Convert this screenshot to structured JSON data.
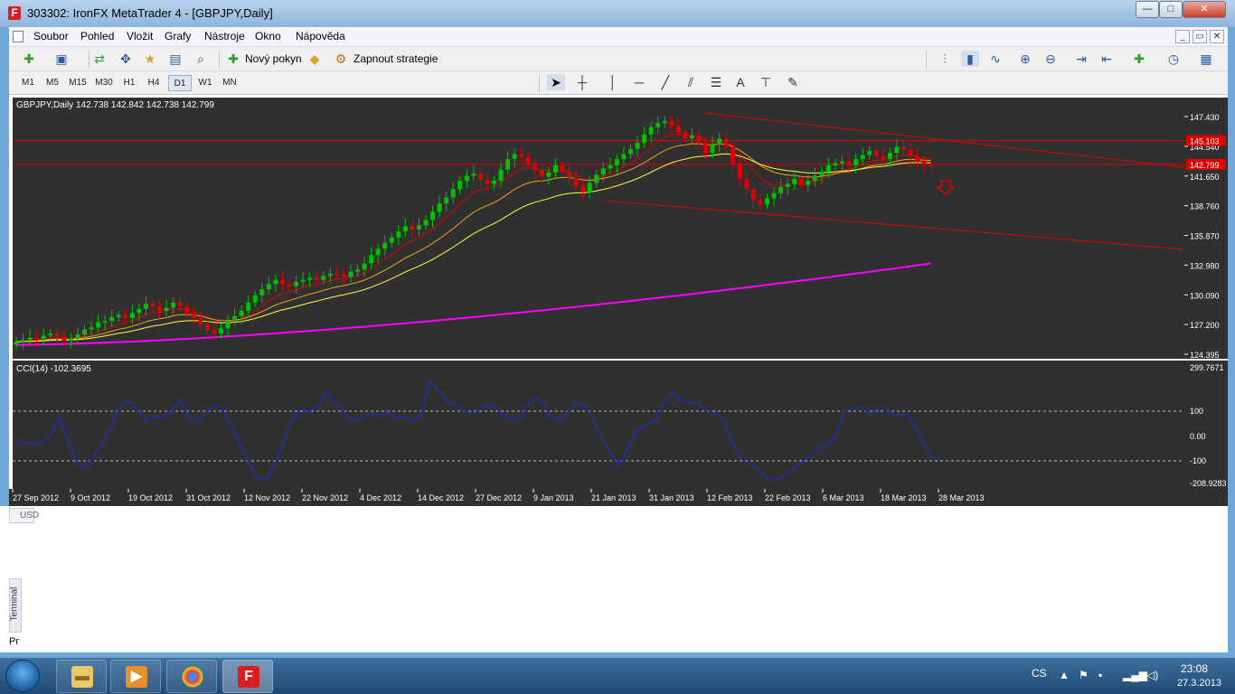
{
  "window": {
    "title": "303302: IronFX MetaTrader 4 - [GBPJPY,Daily]",
    "app_icon_letter": "F",
    "buttons": {
      "minimize": "—",
      "maximize": "□",
      "close": "✕"
    }
  },
  "menu": {
    "items": [
      "Soubor",
      "Pohled",
      "Vložit",
      "Grafy",
      "Nástroje",
      "Okno",
      "Nápověda"
    ],
    "mdi_buttons": [
      "_",
      "▭",
      "✕"
    ]
  },
  "toolbar": {
    "new_order_label": "Nový pokyn",
    "strategy_label": "Zapnout strategie"
  },
  "timeframes": {
    "items": [
      "M1",
      "M5",
      "M15",
      "M30",
      "H1",
      "H4",
      "D1",
      "W1",
      "MN"
    ],
    "active": "D1"
  },
  "drawing_tools": {
    "icons": [
      "cursor-icon",
      "crosshair-icon",
      "vertical-line-icon",
      "horizontal-line-icon",
      "trendline-icon",
      "equidistant-channel-icon",
      "fibonacci-icon",
      "text-icon",
      "text-label-icon",
      "arrows-icon"
    ],
    "text_tool_glyph": "A"
  },
  "chart": {
    "header": "GBPJPY,Daily  142.738 142.842 142.738 142.799",
    "price_labels": [
      "147.430",
      "144.540",
      "141.650",
      "138.760",
      "135.870",
      "132.980",
      "130.090",
      "127.200",
      "124.395"
    ],
    "level_labels": [
      "145.103",
      "142.799"
    ],
    "cci_header": "CCI(14) -102.3695",
    "cci_labels": [
      "299.7671",
      "100",
      "0.00",
      "-100",
      "-208.9283"
    ],
    "date_labels": [
      "27 Sep 2012",
      "9 Oct 2012",
      "19 Oct 2012",
      "31 Oct 2012",
      "12 Nov 2012",
      "22 Nov 2012",
      "4 Dec 2012",
      "14 Dec 2012",
      "27 Dec 2012",
      "9 Jan 2013",
      "21 Jan 2013",
      "31 Jan 2013",
      "12 Feb 2013",
      "22 Feb 2013",
      "6 Mar 2013",
      "18 Mar 2013",
      "28 Mar 2013"
    ],
    "colors": {
      "background": "#303030",
      "bull": "#00c000",
      "bear": "#e00000",
      "level_line": "#e00000",
      "ma200": "#ff00ff",
      "cci": "#1f2db8"
    }
  },
  "chart_data": {
    "type": "candlestick",
    "symbol": "GBPJPY",
    "timeframe": "Daily",
    "ylim": [
      124.395,
      147.43
    ],
    "horizontal_levels": [
      145.103,
      142.799
    ],
    "closes": [
      125.6,
      125.8,
      126.0,
      125.9,
      126.2,
      126.4,
      126.1,
      125.7,
      125.9,
      126.3,
      126.8,
      127.0,
      127.5,
      127.6,
      128.0,
      128.2,
      127.9,
      128.4,
      128.8,
      129.3,
      129.0,
      128.6,
      128.9,
      129.4,
      129.0,
      128.4,
      127.9,
      127.3,
      126.7,
      126.4,
      126.9,
      127.6,
      128.1,
      128.6,
      129.4,
      130.1,
      130.7,
      131.2,
      131.6,
      131.2,
      131.0,
      131.4,
      131.6,
      131.8,
      131.6,
      132.0,
      132.2,
      132.1,
      131.9,
      132.4,
      132.6,
      133.2,
      134.0,
      134.6,
      135.2,
      135.7,
      136.3,
      136.8,
      136.5,
      136.9,
      137.4,
      138.2,
      139.0,
      139.6,
      140.4,
      141.2,
      141.7,
      141.9,
      141.3,
      140.9,
      141.2,
      142.3,
      143.3,
      143.8,
      143.5,
      142.9,
      142.2,
      141.6,
      142.0,
      142.7,
      142.1,
      141.5,
      140.7,
      140.1,
      141.0,
      141.8,
      142.4,
      142.7,
      143.3,
      143.8,
      144.3,
      144.9,
      145.7,
      146.4,
      146.8,
      147.0,
      146.5,
      145.9,
      145.3,
      145.6,
      144.9,
      143.9,
      144.7,
      145.3,
      144.5,
      142.9,
      141.4,
      140.4,
      139.3,
      138.9,
      139.5,
      140.0,
      140.6,
      140.9,
      141.4,
      140.8,
      141.2,
      141.7,
      142.1,
      142.7,
      142.9,
      143.1,
      142.7,
      143.3,
      143.7,
      144.1,
      143.6,
      143.3,
      143.9,
      144.5,
      144.2,
      143.6,
      143.1,
      142.8,
      142.799
    ],
    "series": [
      {
        "name": "CCI(14)",
        "values": [
          -20,
          -35,
          -40,
          -30,
          0,
          70,
          -20,
          -120,
          -140,
          -90,
          -30,
          30,
          120,
          140,
          110,
          60,
          80,
          70,
          100,
          150,
          80,
          50,
          90,
          130,
          100,
          40,
          -40,
          -120,
          -180,
          -190,
          -130,
          -30,
          60,
          110,
          100,
          120,
          180,
          140,
          100,
          60,
          70,
          90,
          80,
          100,
          70,
          80,
          60,
          90,
          230,
          190,
          140,
          130,
          100,
          90,
          110,
          130,
          100,
          70,
          60,
          100,
          160,
          140,
          80,
          60,
          100,
          140,
          120,
          60,
          -20,
          -80,
          -130,
          -50,
          20,
          40,
          60,
          120,
          180,
          150,
          140,
          130,
          110,
          90,
          70,
          -20,
          -100,
          -120,
          -140,
          -180,
          -190,
          -170,
          -150,
          -120,
          -90,
          -60,
          -40,
          -20,
          100,
          110,
          120,
          90,
          110,
          100,
          80,
          90,
          60,
          -20,
          -80,
          -102
        ]
      }
    ],
    "cci_ylim": [
      -208.9283,
      299.7671
    ]
  }
}
